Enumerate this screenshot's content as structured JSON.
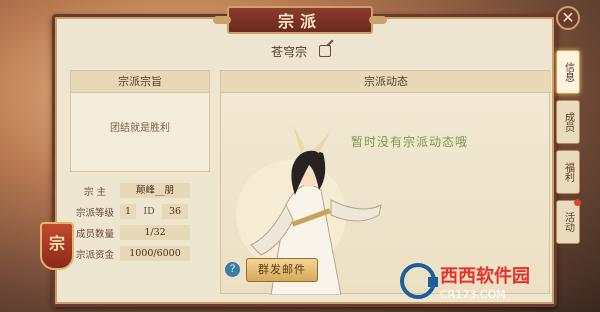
{
  "title": "宗派",
  "sect_name": "苍穹宗",
  "left": {
    "purpose_title": "宗派宗旨",
    "purpose_text": "团结就是胜利",
    "rows": [
      {
        "label": "宗  主",
        "value": "颠峰__朋"
      },
      {
        "label": "宗派等级",
        "value": "1",
        "label2": "ID",
        "value2": "36"
      },
      {
        "label": "成员数量",
        "value": "1/32"
      },
      {
        "label": "宗派资金",
        "value": "1000/6000"
      }
    ]
  },
  "seal_char": "宗",
  "dynamics": {
    "title": "宗派动态",
    "empty_message": "暂时没有宗派动态哦"
  },
  "help_icon_glyph": "?",
  "broadcast_label": "群发邮件",
  "tabs": [
    {
      "label": "信息",
      "active": true
    },
    {
      "label": "成员",
      "active": false
    },
    {
      "label": "福利",
      "active": false
    },
    {
      "label": "活动",
      "active": false,
      "badge": true
    }
  ],
  "close_glyph": "✕",
  "watermark": {
    "brand": "西西软件园",
    "site": "CR173.COM"
  },
  "colors": {
    "frame": "#6b3a2b",
    "accent": "#caa36a",
    "message": "#7a9a4a"
  }
}
